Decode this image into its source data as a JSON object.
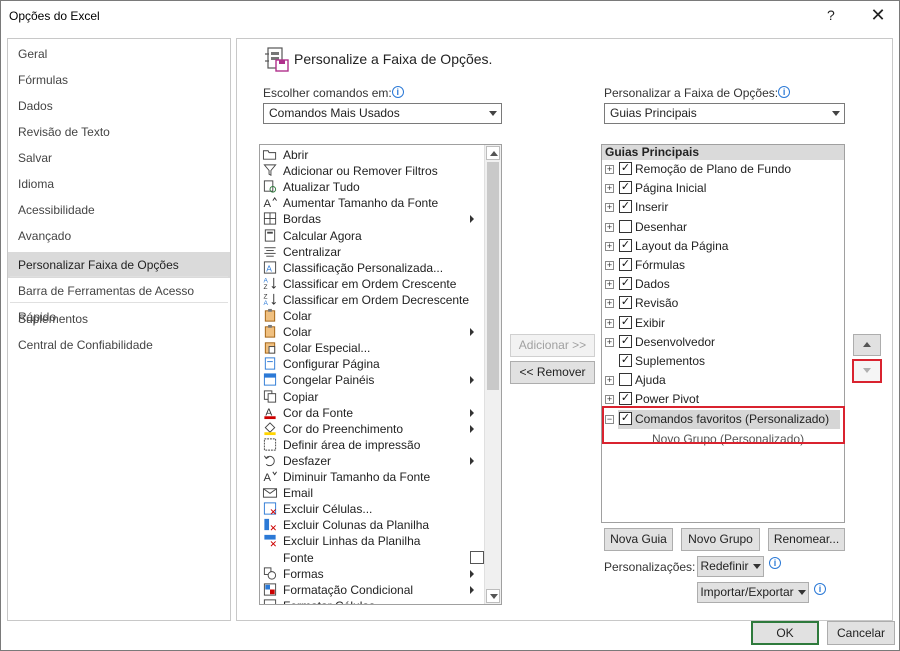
{
  "window": {
    "title": "Opções do Excel",
    "help": "?",
    "close": "✕"
  },
  "nav": {
    "items": [
      {
        "label": "Geral"
      },
      {
        "label": "Fórmulas"
      },
      {
        "label": "Dados"
      },
      {
        "label": "Revisão de Texto"
      },
      {
        "label": "Salvar"
      },
      {
        "label": "Idioma"
      },
      {
        "label": "Acessibilidade"
      },
      {
        "label": "Avançado"
      },
      {
        "label": "Personalizar Faixa de Opções",
        "selected": true
      },
      {
        "label": "Barra de Ferramentas de Acesso Rápido"
      },
      {
        "label": "Suplementos"
      },
      {
        "label": "Central de Confiabilidade"
      }
    ]
  },
  "main": {
    "heading": "Personalize a Faixa de Opções.",
    "left_label": "Escolher comandos em:",
    "left_combo": "Comandos Mais Usados",
    "right_label": "Personalizar a Faixa de Opções:",
    "right_combo": "Guias Principais",
    "info_glyph": "i"
  },
  "commands": [
    {
      "label": "Abrir",
      "icon": "folder-open-icon"
    },
    {
      "label": "Adicionar ou Remover Filtros",
      "icon": "filter-icon"
    },
    {
      "label": "Atualizar Tudo",
      "icon": "refresh-icon"
    },
    {
      "label": "Aumentar Tamanho da Fonte",
      "icon": "font-grow-icon"
    },
    {
      "label": "Bordas",
      "icon": "borders-icon",
      "submenu": true
    },
    {
      "label": "Calcular Agora",
      "icon": "calculator-icon"
    },
    {
      "label": "Centralizar",
      "icon": "align-center-icon"
    },
    {
      "label": "Classificação Personalizada...",
      "icon": "sort-custom-icon"
    },
    {
      "label": "Classificar em Ordem Crescente",
      "icon": "sort-asc-icon"
    },
    {
      "label": "Classificar em Ordem Decrescente",
      "icon": "sort-desc-icon"
    },
    {
      "label": "Colar",
      "icon": "paste-icon"
    },
    {
      "label": "Colar",
      "icon": "paste-icon",
      "submenu": true
    },
    {
      "label": "Colar Especial...",
      "icon": "paste-special-icon"
    },
    {
      "label": "Configurar Página",
      "icon": "page-setup-icon"
    },
    {
      "label": "Congelar Painéis",
      "icon": "freeze-panes-icon",
      "submenu": true
    },
    {
      "label": "Copiar",
      "icon": "copy-icon"
    },
    {
      "label": "Cor da Fonte",
      "icon": "font-color-icon",
      "submenu": true
    },
    {
      "label": "Cor do Preenchimento",
      "icon": "fill-color-icon",
      "submenu": true
    },
    {
      "label": "Definir área de impressão",
      "icon": "print-area-icon"
    },
    {
      "label": "Desfazer",
      "icon": "undo-icon",
      "submenu": true
    },
    {
      "label": "Diminuir Tamanho da Fonte",
      "icon": "font-shrink-icon"
    },
    {
      "label": "Email",
      "icon": "email-icon"
    },
    {
      "label": "Excluir Células...",
      "icon": "delete-cells-icon"
    },
    {
      "label": "Excluir Colunas da Planilha",
      "icon": "delete-columns-icon"
    },
    {
      "label": "Excluir Linhas da Planilha",
      "icon": "delete-rows-icon"
    },
    {
      "label": "Fonte",
      "icon": "font-box-icon"
    },
    {
      "label": "Formas",
      "icon": "shapes-icon",
      "submenu": true
    },
    {
      "label": "Formatação Condicional",
      "icon": "conditional-format-icon",
      "submenu": true
    },
    {
      "label": "Formatar Células",
      "icon": "format-cells-icon"
    }
  ],
  "buttons": {
    "add": "Adicionar >>",
    "remove": "<< Remover",
    "new_tab": "Nova Guia",
    "new_group": "Novo Grupo",
    "rename": "Renomear...",
    "customizations_label": "Personalizações:",
    "reset": "Redefinir",
    "import_export": "Importar/Exportar",
    "ok": "OK",
    "cancel": "Cancelar"
  },
  "tree": {
    "header": "Guias Principais",
    "rows": [
      {
        "label": "Remoção de Plano de Fundo",
        "checked": true,
        "exp": "+"
      },
      {
        "label": "Página Inicial",
        "checked": true,
        "exp": "+"
      },
      {
        "label": "Inserir",
        "checked": true,
        "exp": "+"
      },
      {
        "label": "Desenhar",
        "checked": false,
        "exp": "+"
      },
      {
        "label": "Layout da Página",
        "checked": true,
        "exp": "+"
      },
      {
        "label": "Fórmulas",
        "checked": true,
        "exp": "+"
      },
      {
        "label": "Dados",
        "checked": true,
        "exp": "+"
      },
      {
        "label": "Revisão",
        "checked": true,
        "exp": "+"
      },
      {
        "label": "Exibir",
        "checked": true,
        "exp": "+"
      },
      {
        "label": "Desenvolvedor",
        "checked": true,
        "exp": "+"
      },
      {
        "label": "Suplementos",
        "checked": true,
        "exp": ""
      },
      {
        "label": "Ajuda",
        "checked": false,
        "exp": "+"
      },
      {
        "label": "Power Pivot",
        "checked": true,
        "exp": "+"
      },
      {
        "label": "Comandos favoritos (Personalizado)",
        "checked": true,
        "exp": "−",
        "selected": true
      }
    ],
    "subgroup": "Novo Grupo (Personalizado)"
  },
  "colors": {
    "highlight": "#d9232f",
    "selection": "#dadada",
    "ok_border": "#2e7a3c"
  }
}
